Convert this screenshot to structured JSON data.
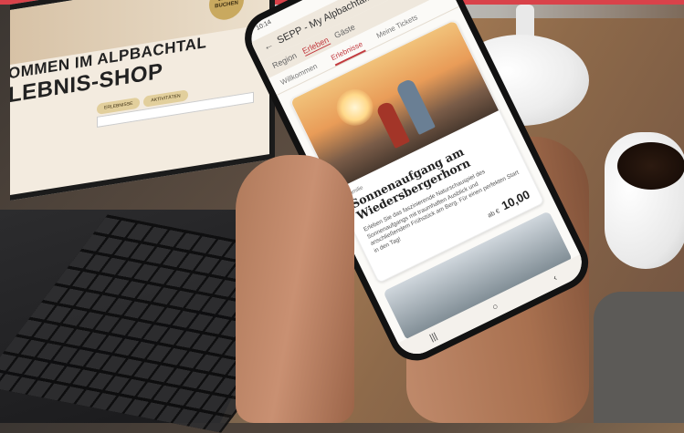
{
  "laptop": {
    "badge": "JETZT BUCHEN",
    "title_line1": "OMMEN IM ALPBACHTAL",
    "title_line2": "LEBNIS-SHOP",
    "btn1": "ERLEBNISSE",
    "btn2": "AKTIVITÄTEN"
  },
  "phone": {
    "time": "10:14",
    "app_title": "SEPP - My Alpbachtal...",
    "tabs": [
      "Region",
      "Erleben",
      "Gäste"
    ],
    "subtabs": [
      "Willkommen",
      "Erlebnisse",
      "Meine Tickets"
    ],
    "card": {
      "category": "Familie",
      "title": "Sonnenaufgang am Wiedersbergerhorn",
      "description": "Erleben Sie das faszinierende Naturschauspiel des Sonnenaufgangs mit traumhaften Ausblick und anschließendem Frühstück am Berg. Für einen perfekten Start in den Tag!",
      "price_prefix": "ab €",
      "price": "10,00"
    },
    "nav": [
      "|||",
      "○",
      "‹"
    ]
  }
}
